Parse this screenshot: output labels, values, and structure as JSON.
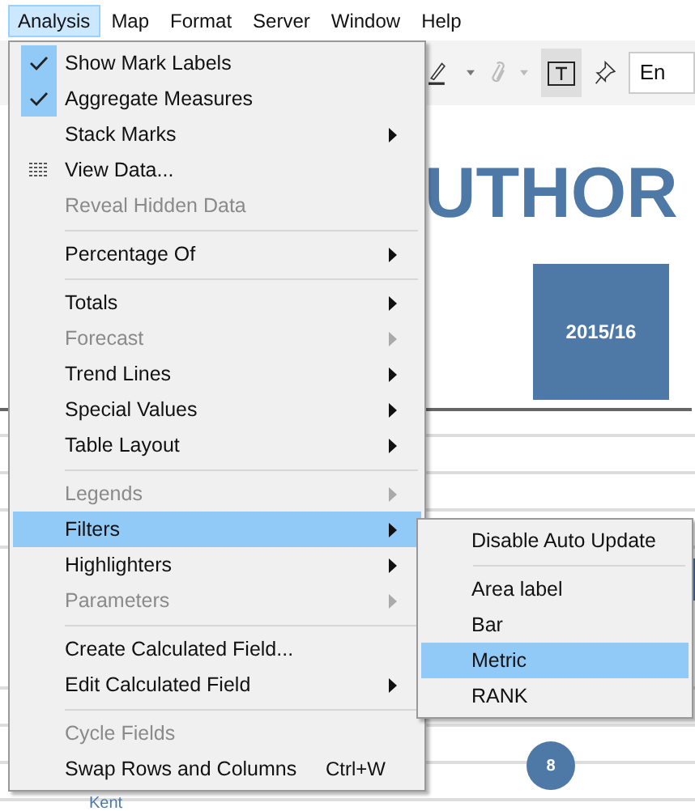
{
  "menubar": [
    {
      "label": "Analysis",
      "selected": true
    },
    {
      "label": "Map",
      "selected": false
    },
    {
      "label": "Format",
      "selected": false
    },
    {
      "label": "Server",
      "selected": false
    },
    {
      "label": "Window",
      "selected": false
    },
    {
      "label": "Help",
      "selected": false
    }
  ],
  "toolbar": {
    "field_value": "En"
  },
  "dashboard": {
    "title": "UTHOR",
    "tile": "2015/16",
    "circle": "8",
    "row_label": "Kent"
  },
  "menu": {
    "items": [
      {
        "kind": "item",
        "label": "Show Mark Labels",
        "checked": true,
        "disabled": false,
        "submenu": false,
        "selected": false
      },
      {
        "kind": "item",
        "label": "Aggregate Measures",
        "checked": true,
        "disabled": false,
        "submenu": false,
        "selected": false
      },
      {
        "kind": "item",
        "label": "Stack Marks",
        "checked": false,
        "disabled": false,
        "submenu": true,
        "selected": false
      },
      {
        "kind": "item",
        "label": "View Data...",
        "checked": false,
        "disabled": false,
        "submenu": false,
        "selected": false,
        "icon": true
      },
      {
        "kind": "item",
        "label": "Reveal Hidden Data",
        "checked": false,
        "disabled": true,
        "submenu": false,
        "selected": false
      },
      {
        "kind": "separator"
      },
      {
        "kind": "item",
        "label": "Percentage Of",
        "checked": false,
        "disabled": false,
        "submenu": true,
        "selected": false
      },
      {
        "kind": "separator"
      },
      {
        "kind": "item",
        "label": "Totals",
        "checked": false,
        "disabled": false,
        "submenu": true,
        "selected": false
      },
      {
        "kind": "item",
        "label": "Forecast",
        "checked": false,
        "disabled": true,
        "submenu": true,
        "selected": false
      },
      {
        "kind": "item",
        "label": "Trend Lines",
        "checked": false,
        "disabled": false,
        "submenu": true,
        "selected": false
      },
      {
        "kind": "item",
        "label": "Special Values",
        "checked": false,
        "disabled": false,
        "submenu": true,
        "selected": false
      },
      {
        "kind": "item",
        "label": "Table Layout",
        "checked": false,
        "disabled": false,
        "submenu": true,
        "selected": false
      },
      {
        "kind": "separator"
      },
      {
        "kind": "item",
        "label": "Legends",
        "checked": false,
        "disabled": true,
        "submenu": true,
        "selected": false
      },
      {
        "kind": "item",
        "label": "Filters",
        "checked": false,
        "disabled": false,
        "submenu": true,
        "selected": true
      },
      {
        "kind": "item",
        "label": "Highlighters",
        "checked": false,
        "disabled": false,
        "submenu": true,
        "selected": false
      },
      {
        "kind": "item",
        "label": "Parameters",
        "checked": false,
        "disabled": true,
        "submenu": true,
        "selected": false
      },
      {
        "kind": "separator"
      },
      {
        "kind": "item",
        "label": "Create Calculated Field...",
        "checked": false,
        "disabled": false,
        "submenu": false,
        "selected": false
      },
      {
        "kind": "item",
        "label": "Edit Calculated Field",
        "checked": false,
        "disabled": false,
        "submenu": true,
        "selected": false
      },
      {
        "kind": "separator"
      },
      {
        "kind": "item",
        "label": "Cycle Fields",
        "checked": false,
        "disabled": true,
        "submenu": false,
        "selected": false
      },
      {
        "kind": "item",
        "label": "Swap Rows and Columns",
        "checked": false,
        "disabled": false,
        "submenu": false,
        "selected": false,
        "shortcut": "Ctrl+W"
      }
    ]
  },
  "submenu": {
    "items": [
      {
        "kind": "item",
        "label": "Disable Auto Update",
        "selected": false
      },
      {
        "kind": "separator"
      },
      {
        "kind": "item",
        "label": "Area label",
        "selected": false
      },
      {
        "kind": "item",
        "label": "Bar",
        "selected": false
      },
      {
        "kind": "item",
        "label": "Metric",
        "selected": true
      },
      {
        "kind": "item",
        "label": "RANK",
        "selected": false
      }
    ]
  }
}
